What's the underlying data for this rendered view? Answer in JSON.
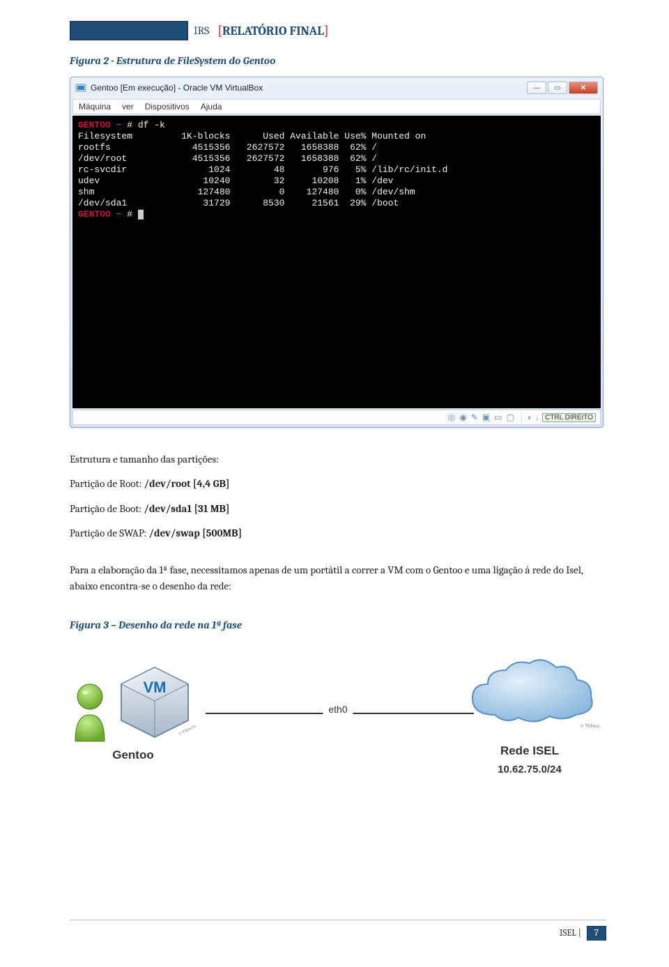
{
  "header": {
    "irs": "IRS",
    "title": "RELATÓRIO FINAL"
  },
  "fig1": {
    "caption": "Figura 2 -  Estrutura de FileSystem do Gentoo"
  },
  "vbox": {
    "title": "Gentoo [Em execução] - Oracle VM VirtualBox",
    "menu": [
      "Máquina",
      "ver",
      "Dispositivos",
      "Ajuda"
    ],
    "status_key": "CTRL DIREITO"
  },
  "terminal": {
    "prompt_host": "GENTOO",
    "prompt_tilde": "~",
    "prompt_hash": "#",
    "command": "df -k",
    "columns": {
      "c1": "Filesystem",
      "c2": "1K-blocks",
      "c3": "Used",
      "c4": "Available",
      "c5": "Use%",
      "c6": "Mounted on"
    },
    "rows": [
      {
        "fs": "rootfs",
        "blocks": "4515356",
        "used": "2627572",
        "avail": "1658388",
        "usep": "62%",
        "mount": "/"
      },
      {
        "fs": "/dev/root",
        "blocks": "4515356",
        "used": "2627572",
        "avail": "1658388",
        "usep": "62%",
        "mount": "/"
      },
      {
        "fs": "rc-svcdir",
        "blocks": "1024",
        "used": "48",
        "avail": "976",
        "usep": "5%",
        "mount": "/lib/rc/init.d"
      },
      {
        "fs": "udev",
        "blocks": "10240",
        "used": "32",
        "avail": "10208",
        "usep": "1%",
        "mount": "/dev"
      },
      {
        "fs": "shm",
        "blocks": "127480",
        "used": "0",
        "avail": "127480",
        "usep": "0%",
        "mount": "/dev/shm"
      },
      {
        "fs": "/dev/sda1",
        "blocks": "31729",
        "used": "8530",
        "avail": "21561",
        "usep": "29%",
        "mount": "/boot"
      }
    ]
  },
  "partitions": {
    "intro": "Estrutura e tamanho das partições:",
    "root_label": "Partição de Root: ",
    "root_val": "/dev/root  [4,4 GB]",
    "boot_label": "Partição de Boot: ",
    "boot_val": "/dev/sda1 [31 MB]",
    "swap_label": "Partição de SWAP: ",
    "swap_val": "/dev/swap [500MB]"
  },
  "paragraph": "Para a elaboração da 1ª fase, necessitamos apenas de um portátil a correr a VM com o Gentoo e uma ligação á rede do Isel, abaixo encontra-se o desenho da rede:",
  "fig2": {
    "caption": "Figura  3 – Desenho da rede na 1ª fase",
    "vm_text": "VM",
    "gentoo": "Gentoo",
    "eth": "eth0",
    "cloud_name": "Rede ISEL",
    "cloud_ip": "10.62.75.0/24"
  },
  "footer": {
    "label": "ISEL |",
    "page": "7"
  }
}
